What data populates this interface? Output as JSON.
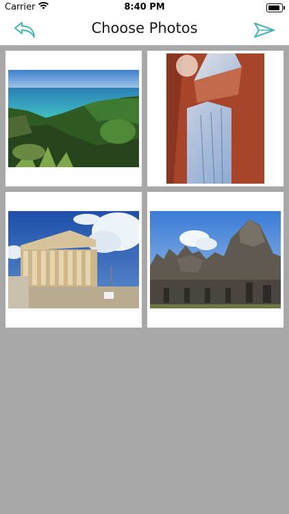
{
  "status": {
    "carrier": "Carrier",
    "time": "8:40 PM"
  },
  "nav": {
    "title": "Choose Photos"
  },
  "colors": {
    "accent": "#3fb3b0",
    "background": "#a8a8a8",
    "card": "#ffffff"
  },
  "photos": [
    {
      "name": "photo-coastline",
      "subject": "tropical coastline"
    },
    {
      "name": "photo-bridge",
      "subject": "suspension bridge tower"
    },
    {
      "name": "photo-parthenon",
      "subject": "ancient greek temple"
    },
    {
      "name": "photo-temple-ruins",
      "subject": "stone temple ruins"
    }
  ]
}
